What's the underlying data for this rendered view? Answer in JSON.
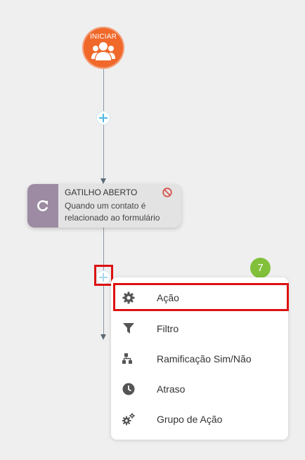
{
  "start": {
    "label": "INICIAR",
    "icon": "users-icon",
    "color": "#f0682a"
  },
  "trigger": {
    "title": "GATILHO ABERTO",
    "description": "Quando um contato é relacionado ao formulário",
    "icon": "refresh-icon",
    "delete_icon": "delete-icon"
  },
  "step_badge": "7",
  "menu": {
    "items": [
      {
        "label": "Ação",
        "icon": "gear-icon"
      },
      {
        "label": "Filtro",
        "icon": "filter-icon"
      },
      {
        "label": "Ramificação Sim/Não",
        "icon": "branch-icon"
      },
      {
        "label": "Atraso",
        "icon": "clock-icon"
      },
      {
        "label": "Grupo de Ação",
        "icon": "gears-icon"
      }
    ]
  },
  "colors": {
    "highlight": "#dd1111",
    "badge": "#82c03a",
    "trigger_side": "#9c8ba3"
  }
}
